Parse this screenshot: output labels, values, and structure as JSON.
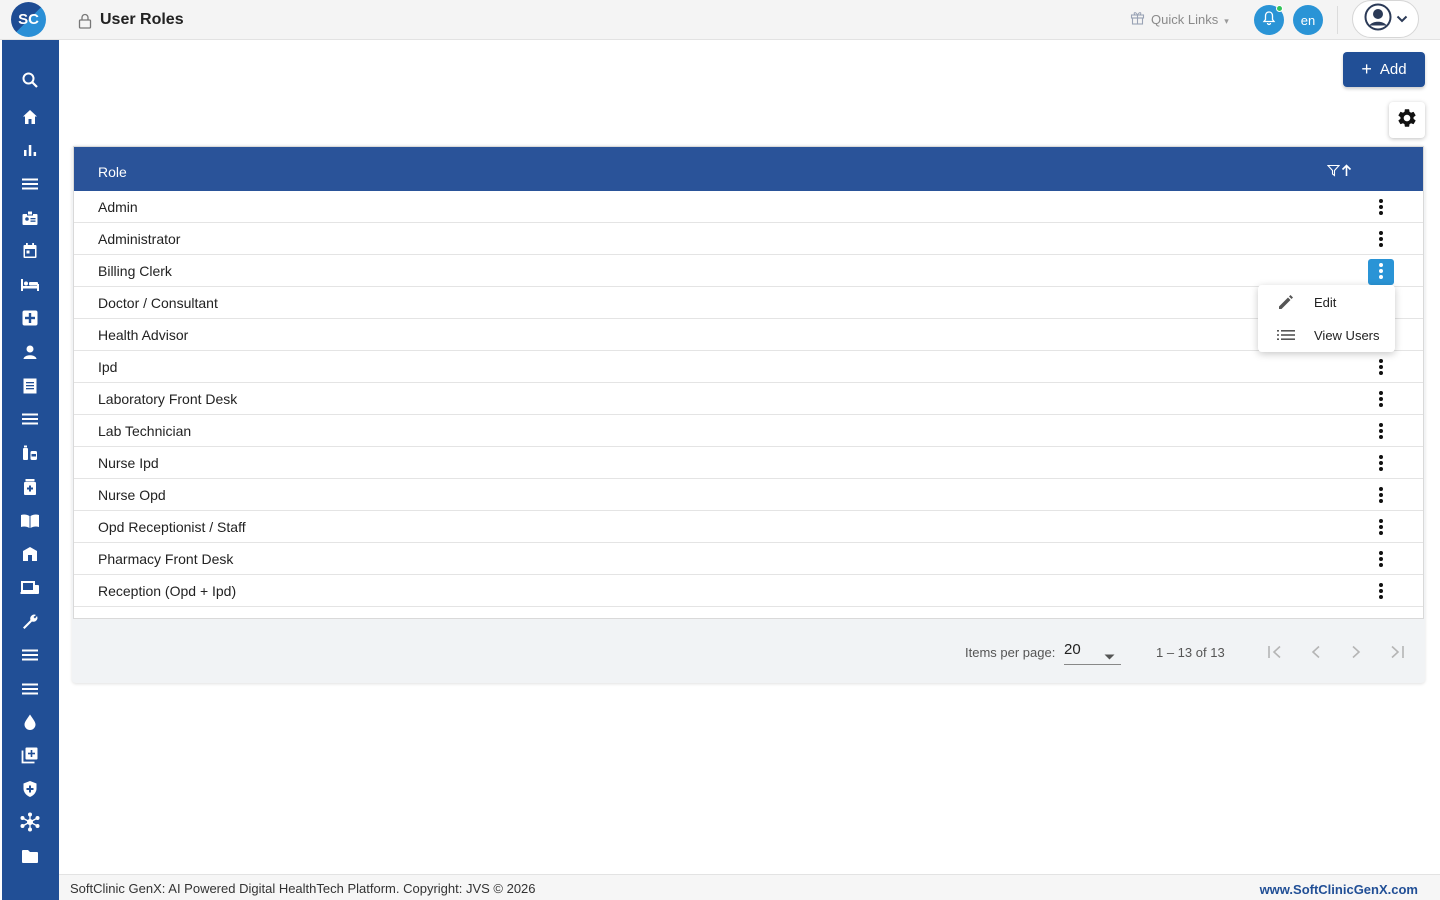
{
  "header": {
    "logo_text": "SC",
    "page_title": "User Roles",
    "quick_links_label": "Quick Links",
    "language": "en"
  },
  "sidebar": {
    "icons": [
      "search-icon",
      "home-icon",
      "bar-chart-icon",
      "menu-lines-icon",
      "id-badge-icon",
      "calendar-icon",
      "bed-icon",
      "medical-plus-icon",
      "person-icon",
      "document-icon",
      "list-icon",
      "pills-icon",
      "medicine-box-icon",
      "book-icon",
      "building-icon",
      "devices-icon",
      "wrench-icon",
      "list-icon-2",
      "list-icon-3",
      "drop-icon",
      "add-copy-icon",
      "shield-plus-icon",
      "network-icon",
      "folder-icon"
    ]
  },
  "toolbar": {
    "add_label": "Add"
  },
  "table": {
    "column_header": "Role",
    "rows": [
      "Admin",
      "Administrator",
      "Billing Clerk",
      "Doctor / Consultant",
      "Health Advisor",
      "Ipd",
      "Laboratory Front Desk",
      "Lab Technician",
      "Nurse Ipd",
      "Nurse Opd",
      "Opd Receptionist / Staff",
      "Pharmacy Front Desk",
      "Reception (Opd + Ipd)"
    ],
    "active_row_index": 2
  },
  "row_menu": {
    "edit_label": "Edit",
    "view_users_label": "View Users"
  },
  "paginator": {
    "items_per_page_label": "Items per page:",
    "items_per_page_value": "20",
    "range_label": "1 – 13 of 13"
  },
  "footer": {
    "copyright": "SoftClinic GenX: AI Powered Digital HealthTech Platform. Copyright: JVS © 2026",
    "website": "www.SoftClinicGenX.com"
  },
  "colors": {
    "primary": "#214f96",
    "accent": "#2a94d6",
    "table_header": "#2a5399"
  }
}
